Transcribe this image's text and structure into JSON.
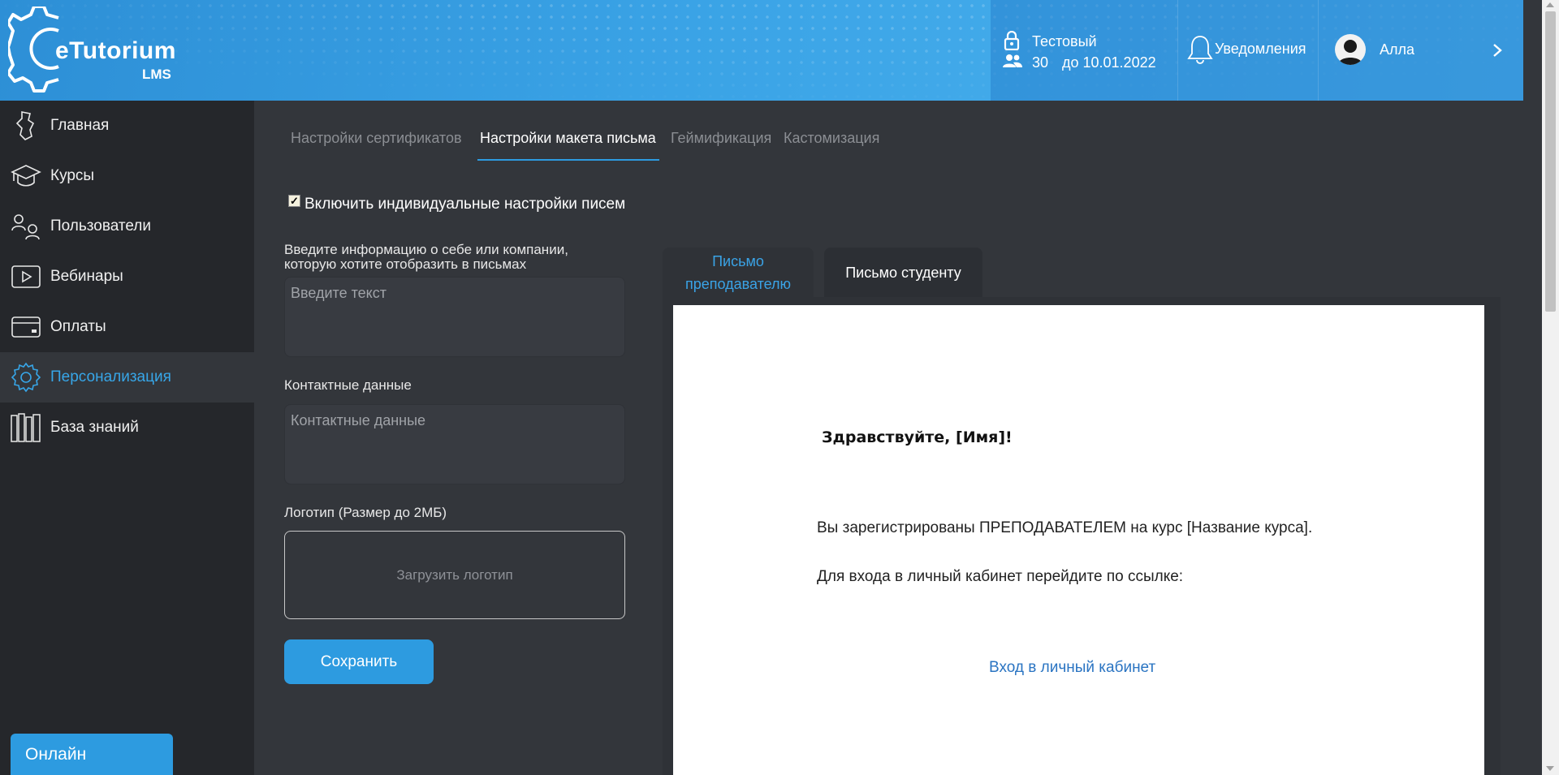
{
  "header": {
    "logo_text": "eTutorium",
    "logo_sub": "LMS",
    "plan_name": "Тестовый",
    "users_count": "30",
    "valid_until": "до 10.01.2022",
    "notifications_label": "Уведомления",
    "user_name": "Алла"
  },
  "sidebar": {
    "items": [
      {
        "label": "Главная",
        "icon": "home-map-icon"
      },
      {
        "label": "Курсы",
        "icon": "graduation-cap-icon"
      },
      {
        "label": "Пользователи",
        "icon": "users-icon"
      },
      {
        "label": "Вебинары",
        "icon": "play-icon"
      },
      {
        "label": "Оплаты",
        "icon": "credit-card-icon"
      },
      {
        "label": "Персонализация",
        "icon": "gear-icon"
      },
      {
        "label": "База знаний",
        "icon": "books-icon"
      }
    ],
    "active_index": 5,
    "online_label": "Онлайн"
  },
  "tabs": [
    {
      "label": "Настройки сертификатов"
    },
    {
      "label": "Настройки макета письма"
    },
    {
      "label": "Геймификация"
    },
    {
      "label": "Кастомизация"
    }
  ],
  "form": {
    "individual_checkbox_label": "Включить индивидуальные настройки писем",
    "individual_checked": true,
    "about_label_line1": "Введите информацию о себе или компании,",
    "about_label_line2": "которую хотите отобразить в письмах",
    "about_placeholder": "Введите текст",
    "contacts_label": "Контактные данные",
    "contacts_placeholder": "Контактные данные",
    "logo_label": "Логотип (Размер до 2МБ)",
    "upload_label": "Загрузить логотип",
    "save_label": "Сохранить"
  },
  "letter": {
    "tab_teacher_line1": "Письмо",
    "tab_teacher_line2": "преподавателю",
    "tab_student": "Письмо студенту",
    "greeting": "Здравствуйте, [Имя]!",
    "body_line1": "Вы зарегистрированы ПРЕПОДАВАТЕЛЕМ на курс [Название курса].",
    "body_line2": "Для входа в личный кабинет перейдите по ссылке:",
    "link_label": "Вход в личный кабинет"
  },
  "colors": {
    "accent": "#2d9be0",
    "sidebar_bg": "#25272b",
    "main_bg": "#33363b"
  }
}
